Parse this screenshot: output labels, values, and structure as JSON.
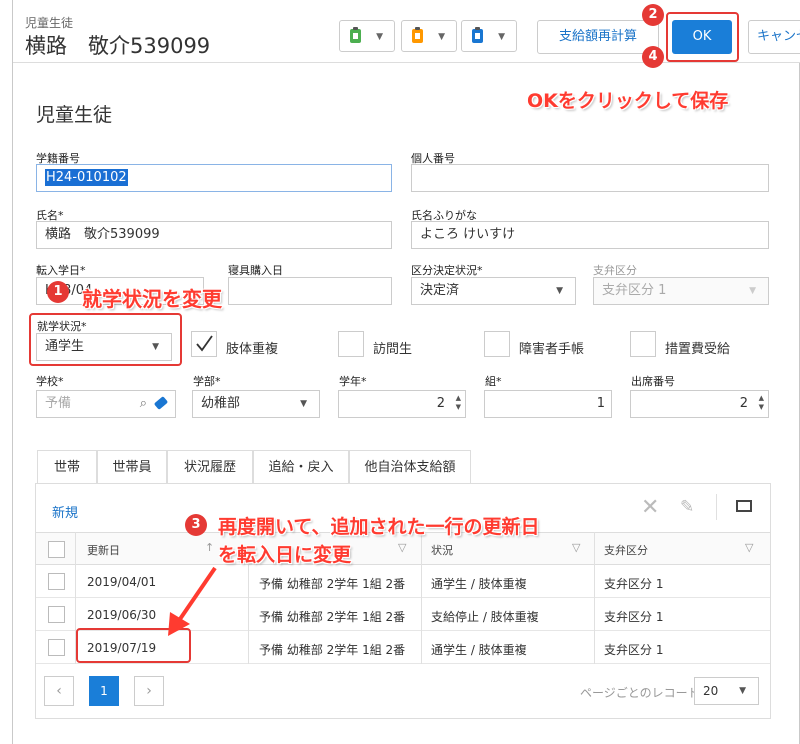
{
  "header": {
    "subtitle": "児童生徒",
    "title": "横路　敬介539099",
    "recalc_label": "支給額再計算",
    "ok_label": "OK",
    "cancel_label": "キャンセル"
  },
  "section_title": "児童生徒",
  "fields": {
    "student_number": {
      "label": "学籍番号",
      "value": "H24-010102"
    },
    "personal_number": {
      "label": "個人番号",
      "value": ""
    },
    "name": {
      "label": "氏名*",
      "value": "横路　敬介539099"
    },
    "name_kana": {
      "label": "氏名ふりがな",
      "value": "よころ けいすけ"
    },
    "transfer_date": {
      "label": "転入学日*",
      "value": "H18/04"
    },
    "bedding_date": {
      "label": "寝具購入日",
      "value": ""
    },
    "decision_status": {
      "label": "区分決定状況*",
      "value": "決定済"
    },
    "payment_category": {
      "label": "支弁区分",
      "value": "支弁区分 1"
    },
    "attendance_status": {
      "label": "就学状況*",
      "value": "通学生"
    },
    "school": {
      "label": "学校*",
      "value": "予備"
    },
    "department": {
      "label": "学部*",
      "value": "幼稚部"
    },
    "grade": {
      "label": "学年*",
      "value": "2"
    },
    "class": {
      "label": "組*",
      "value": "1"
    },
    "seat_number": {
      "label": "出席番号",
      "value": "2"
    }
  },
  "checkboxes": [
    {
      "label": "肢体重複",
      "checked": true
    },
    {
      "label": "訪問生",
      "checked": false
    },
    {
      "label": "障害者手帳",
      "checked": false
    },
    {
      "label": "措置費受給",
      "checked": false
    }
  ],
  "tabs": [
    "世帯",
    "世帯員",
    "状況履歴",
    "追給・戻入",
    "他自治体支給額"
  ],
  "active_tab": "状況履歴",
  "grid": {
    "new_label": "新規",
    "columns": [
      "更新日",
      "状況",
      "支弁区分"
    ],
    "rows": [
      {
        "date": "2019/04/01",
        "school": "予備 幼稚部 2学年 1組 2番",
        "status": "通学生 / 肢体重複",
        "category": "支弁区分 1"
      },
      {
        "date": "2019/06/30",
        "school": "予備 幼稚部 2学年 1組 2番",
        "status": "支給停止 / 肢体重複",
        "category": "支弁区分 1"
      },
      {
        "date": "2019/07/19",
        "school": "予備 幼稚部 2学年 1組 2番",
        "status": "通学生 / 肢体重複",
        "category": "支弁区分 1"
      }
    ]
  },
  "pagination": {
    "current_page": "1",
    "per_page_label": "ページごとのレコード数",
    "per_page_value": "20"
  },
  "annotations": {
    "badge1": "1",
    "badge2": "2",
    "badge3": "3",
    "badge4": "4",
    "note_ok": "OKをクリックして保存",
    "note_status": "就学状況を変更",
    "note_reopen_1": "再度開いて、追加された一行の更新日",
    "note_reopen_2": "を転入日に変更"
  },
  "colors": {
    "primary": "#1a7ed8",
    "link": "#1a73c8",
    "annotation": "#e53935"
  }
}
